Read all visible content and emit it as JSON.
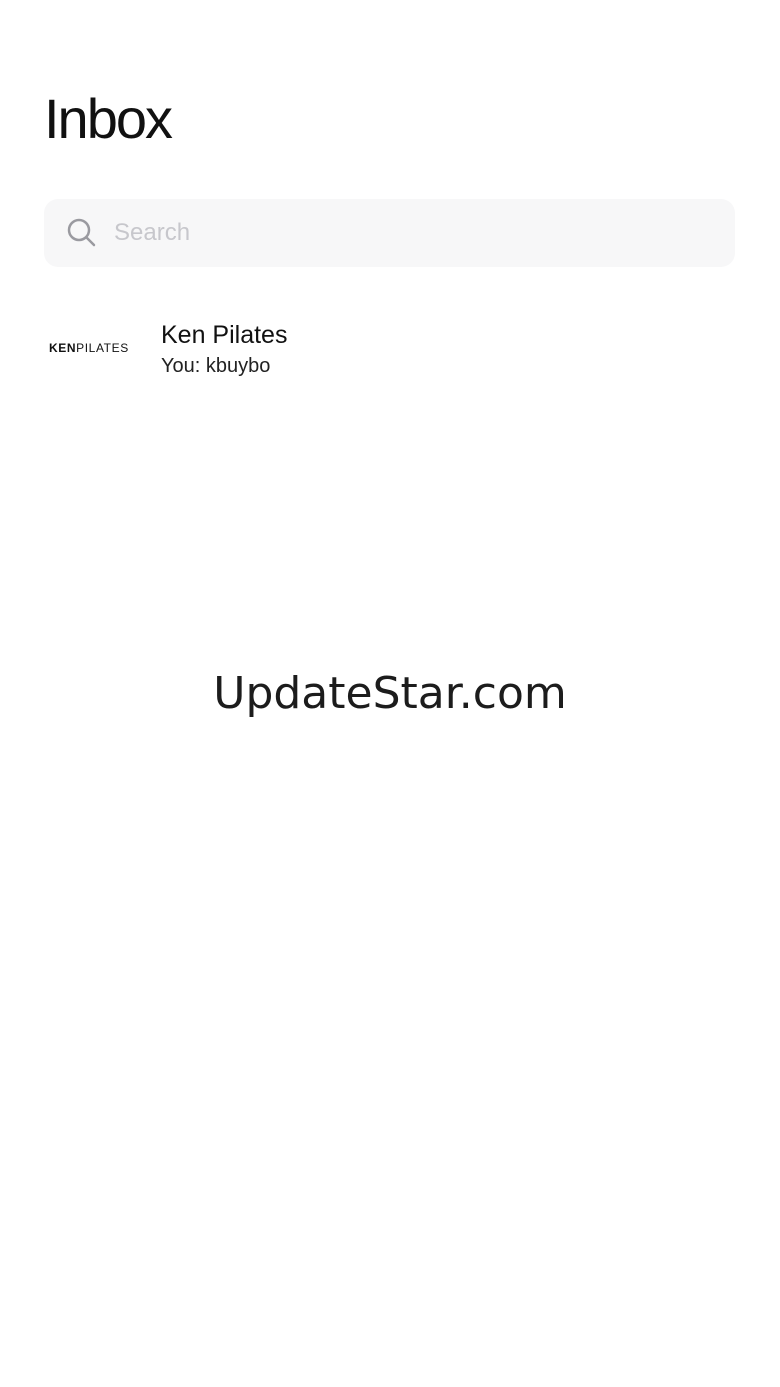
{
  "header": {
    "title": "Inbox"
  },
  "search": {
    "placeholder": "Search",
    "icon": "search-icon"
  },
  "conversations": [
    {
      "avatar_logo_bold": "KEN",
      "avatar_logo_light": "PILATES",
      "name": "Ken Pilates",
      "preview": "You: kbuybo"
    }
  ],
  "watermark": {
    "text": "UpdateStar.com"
  },
  "colors": {
    "background": "#ffffff",
    "search_background": "#f7f7f8",
    "placeholder": "#c7c7cc",
    "text": "#111111"
  }
}
